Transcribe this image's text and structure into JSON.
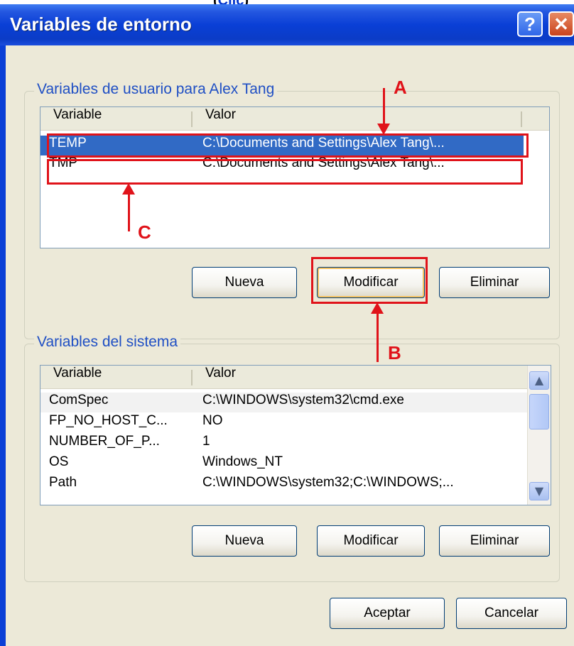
{
  "caption_fragment": {
    "prefix": "(",
    "link": "Clic",
    "suffix": ")"
  },
  "window": {
    "title": "Variables de entorno",
    "help_icon": "?",
    "close_icon": "✕"
  },
  "user_vars": {
    "legend": "Variables de usuario para Alex Tang",
    "columns": [
      "Variable",
      "Valor"
    ],
    "rows": [
      {
        "name": "TEMP",
        "value": "C:\\Documents and Settings\\Alex Tang\\...",
        "selected": true
      },
      {
        "name": "TMP",
        "value": "C:\\Documents and Settings\\Alex Tang\\...",
        "selected": false
      }
    ],
    "buttons": {
      "new": "Nueva",
      "edit": "Modificar",
      "delete": "Eliminar"
    }
  },
  "system_vars": {
    "legend": "Variables del sistema",
    "columns": [
      "Variable",
      "Valor"
    ],
    "rows": [
      {
        "name": "ComSpec",
        "value": "C:\\WINDOWS\\system32\\cmd.exe"
      },
      {
        "name": "FP_NO_HOST_C...",
        "value": "NO"
      },
      {
        "name": "NUMBER_OF_P...",
        "value": "1"
      },
      {
        "name": "OS",
        "value": "Windows_NT"
      },
      {
        "name": "Path",
        "value": "C:\\WINDOWS\\system32;C:\\WINDOWS;..."
      }
    ],
    "buttons": {
      "new": "Nueva",
      "edit": "Modificar",
      "delete": "Eliminar"
    },
    "scroll_up_icon": "▲",
    "scroll_down_icon": "▼"
  },
  "footer": {
    "ok": "Aceptar",
    "cancel": "Cancelar"
  },
  "annotations": {
    "a": "A",
    "b": "B",
    "c": "C",
    "color": "#e0131a"
  },
  "colors": {
    "selection": "#316ac5",
    "titlebar": "#0a3fd6",
    "dialog_bg": "#ece9d8",
    "group_label": "#1f4fc4"
  }
}
